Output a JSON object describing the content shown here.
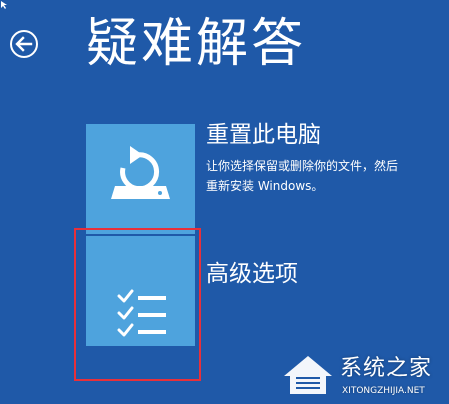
{
  "header": {
    "title": "疑难解答",
    "back_icon": "back-arrow-icon"
  },
  "options": [
    {
      "title": "重置此电脑",
      "description_line1": "让你选择保留或删除你的文件，然后",
      "description_line2": "重新安装 Windows。",
      "icon": "reset-pc-icon"
    },
    {
      "title": "高级选项",
      "icon": "checklist-icon"
    }
  ],
  "watermark": {
    "name": "系统之家",
    "url": "XITONGZHIJIA.NET"
  },
  "colors": {
    "background": "#1f59a8",
    "tile": "#4ea3dd",
    "highlight": "#e8303a",
    "text": "#ffffff"
  }
}
